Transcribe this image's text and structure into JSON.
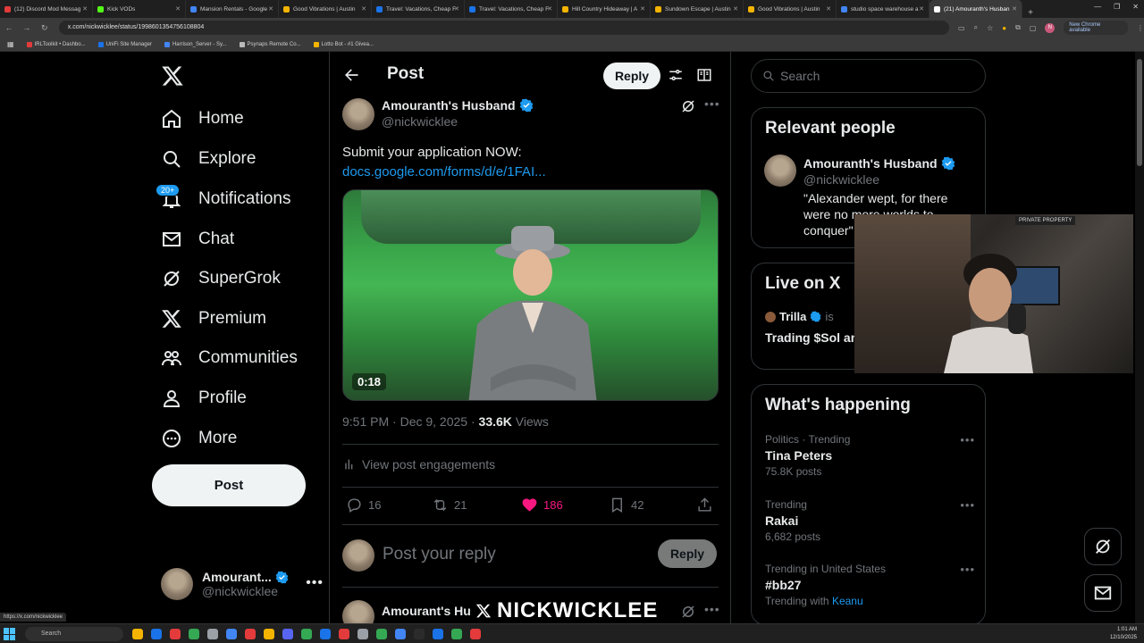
{
  "browser": {
    "tabs": [
      {
        "label": "(12) Discord Mod Messag",
        "color": "#e33b3b"
      },
      {
        "label": "Kick VODs",
        "color": "#53fc18"
      },
      {
        "label": "Mansion Rentals - Google",
        "color": "#4285f4"
      },
      {
        "label": "Good Vibrations | Austin",
        "color": "#f4b400"
      },
      {
        "label": "Travel: Vacations, Cheap F",
        "color": "#1a73e8"
      },
      {
        "label": "Travel: Vacations, Cheap F",
        "color": "#1a73e8"
      },
      {
        "label": "Hill Country Hideaway | A",
        "color": "#f4b400"
      },
      {
        "label": "Sundown Escape | Austin",
        "color": "#f4b400"
      },
      {
        "label": "Good Vibrations | Austin",
        "color": "#f4b400"
      },
      {
        "label": "studio space warehouse a",
        "color": "#4285f4"
      },
      {
        "label": "(21) Amouranth's Husban",
        "color": "#ffffff"
      }
    ],
    "url": "x.com/nickwicklee/status/1998601354756108804",
    "update_label": "New Chrome available",
    "profile_initial": "N",
    "bookmarks": [
      {
        "label": "IRLToolkit • Dashbo...",
        "color": "#e33b3b"
      },
      {
        "label": "UniFi Site Manager",
        "color": "#1a73e8"
      },
      {
        "label": "Harrison_Server - Sy...",
        "color": "#4285f4"
      },
      {
        "label": "Psynaps Remote Co...",
        "color": "#bbbbbb"
      },
      {
        "label": "Lotto Bot - #1 Givea...",
        "color": "#f4b400"
      }
    ]
  },
  "nav": {
    "items": [
      {
        "label": "Home",
        "icon": "home-icon"
      },
      {
        "label": "Explore",
        "icon": "search-icon"
      },
      {
        "label": "Notifications",
        "icon": "bell-icon"
      },
      {
        "label": "Chat",
        "icon": "mail-icon"
      },
      {
        "label": "SuperGrok",
        "icon": "grok-icon"
      },
      {
        "label": "Premium",
        "icon": "x-logo-icon"
      },
      {
        "label": "Communities",
        "icon": "communities-icon"
      },
      {
        "label": "Profile",
        "icon": "profile-icon"
      },
      {
        "label": "More",
        "icon": "more-circle-icon"
      }
    ],
    "notifications_badge": "20+",
    "post_label": "Post",
    "account": {
      "name": "Amourant...",
      "handle": "@nickwicklee"
    }
  },
  "main": {
    "header_title": "Post",
    "reply_label": "Reply",
    "tweet": {
      "author_name": "Amouranth's Husband",
      "author_handle": "@nickwicklee",
      "text": "Submit your application NOW:",
      "link": "docs.google.com/forms/d/e/1FAI...",
      "video_duration": "0:18",
      "time": "9:51 PM · Dec 9, 2025 · ",
      "views_count": "33.6K",
      "views_label": " Views",
      "engagements_label": "View post engagements",
      "replies": "16",
      "reposts": "21",
      "likes": "186",
      "bookmarks": "42"
    },
    "reply_placeholder": "Post your reply",
    "reply_button": "Reply",
    "next_author": "Amourant's Hu"
  },
  "right": {
    "search_placeholder": "Search",
    "relevant": {
      "title": "Relevant people",
      "name": "Amouranth's Husband",
      "handle": "@nickwicklee",
      "bio": "\"Alexander wept, for there were no more worlds to conquer\""
    },
    "live": {
      "title": "Live on X",
      "host": "Trilla",
      "host_suffix": "is",
      "stream_title": "Trading $Sol and Gambling + Give"
    },
    "happening": {
      "title": "What's happening",
      "trends": [
        {
          "context": "Politics · Trending",
          "name": "Tina Peters",
          "count": "75.8K posts"
        },
        {
          "context": "Trending",
          "name": "Rakai",
          "count": "6,682 posts"
        },
        {
          "context": "Trending in United States",
          "name": "#bb27",
          "count_prefix": "Trending with ",
          "count_name": "Keanu"
        }
      ]
    }
  },
  "overlay": {
    "stream_name": "NICKWICKLEE",
    "cam_sign": "PRIVATE PROPERTY"
  },
  "status_url": "https://x.com/nickwicklee",
  "taskbar": {
    "search_placeholder": "Search",
    "time": "1:01 AM",
    "date": "12/10/2025"
  },
  "colors": {
    "accent": "#1d9bf0",
    "like": "#f91880",
    "background": "#000000"
  }
}
